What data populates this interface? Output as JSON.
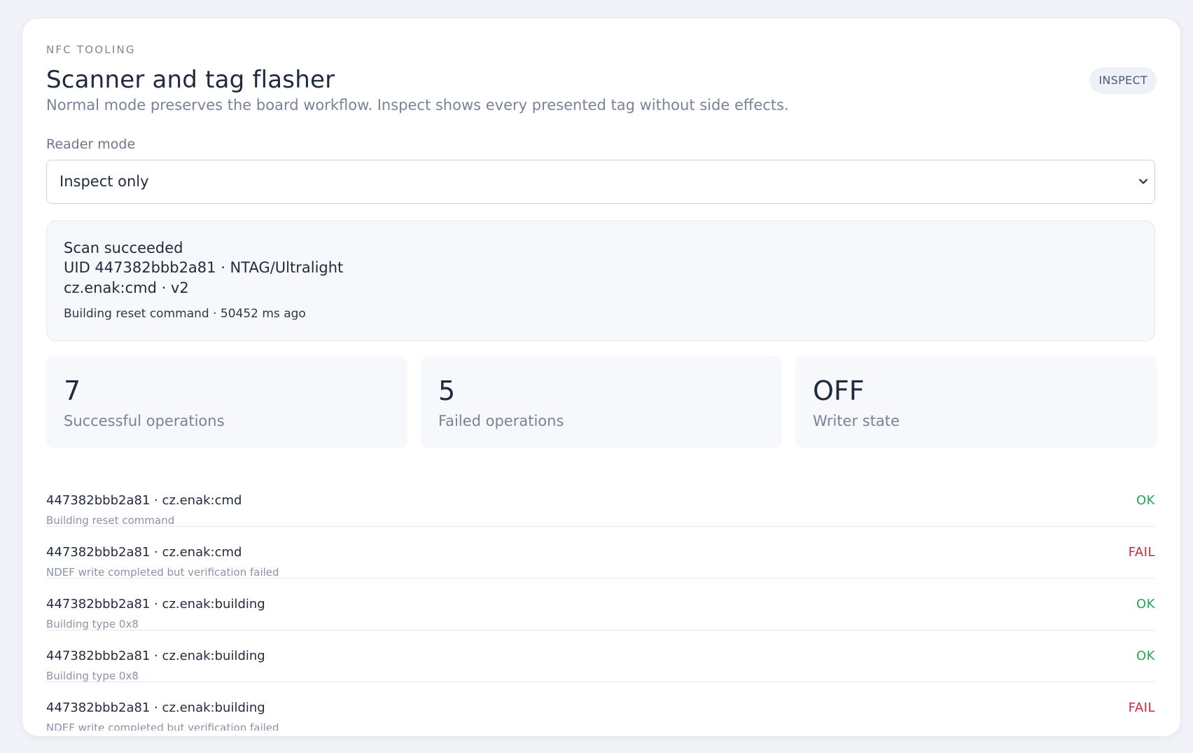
{
  "header": {
    "eyebrow": "NFC TOOLING",
    "title": "Scanner and tag flasher",
    "mode_badge": "INSPECT",
    "subtitle": "Normal mode preserves the board workflow. Inspect shows every presented tag without side effects."
  },
  "reader_mode": {
    "label": "Reader mode",
    "selected": "Inspect only"
  },
  "scan": {
    "title": "Scan succeeded",
    "uid_line": "UID 447382bbb2a81 · NTAG/Ultralight",
    "record_line": "cz.enak:cmd · v2",
    "meta": "Building reset command · 50452 ms ago"
  },
  "stats": [
    {
      "value": "7",
      "label": "Successful operations"
    },
    {
      "value": "5",
      "label": "Failed operations"
    },
    {
      "value": "OFF",
      "label": "Writer state"
    }
  ],
  "log": [
    {
      "main": "447382bbb2a81 · cz.enak:cmd",
      "sub": "Building reset command",
      "status": "OK"
    },
    {
      "main": "447382bbb2a81 · cz.enak:cmd",
      "sub": "NDEF write completed but verification failed",
      "status": "FAIL"
    },
    {
      "main": "447382bbb2a81 · cz.enak:building",
      "sub": "Building type 0x8",
      "status": "OK"
    },
    {
      "main": "447382bbb2a81 · cz.enak:building",
      "sub": "Building type 0x8",
      "status": "OK"
    },
    {
      "main": "447382bbb2a81 · cz.enak:building",
      "sub": "NDEF write completed but verification failed",
      "status": "FAIL"
    }
  ],
  "colors": {
    "ok": "#27a559",
    "fail": "#c62a3c",
    "text": "#1f2a3c",
    "muted": "#78839a"
  },
  "icons": {
    "select_chevron": "chevron-down-icon"
  }
}
